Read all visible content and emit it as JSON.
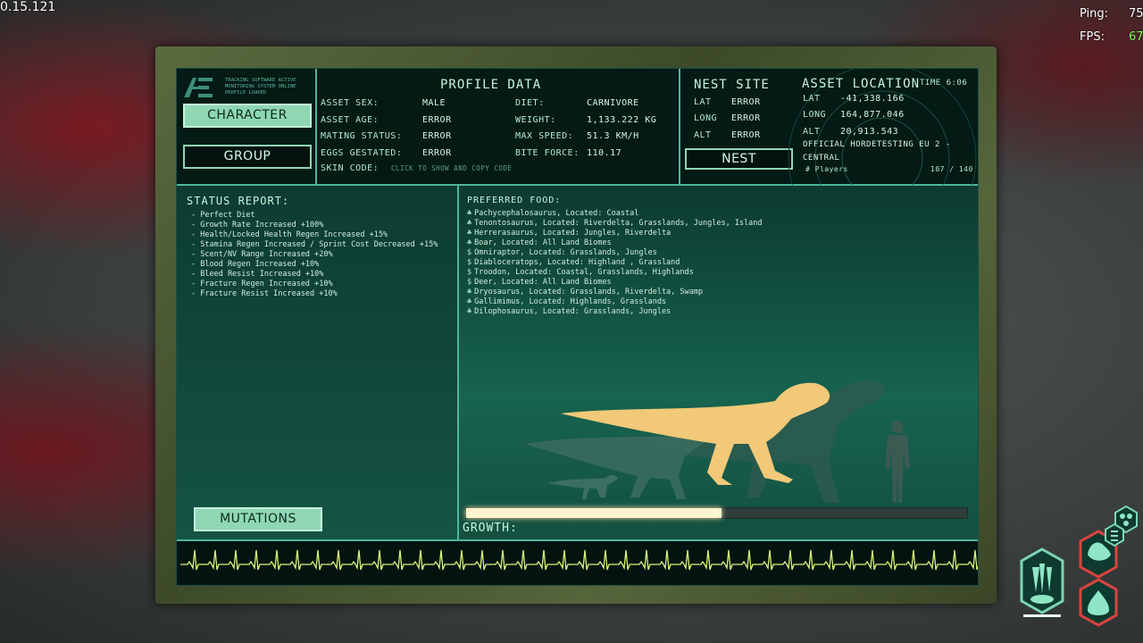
{
  "hud": {
    "version": "0.15.121",
    "ping_label": "Ping:",
    "ping_value": "75",
    "fps_label": "FPS:",
    "fps_value": "67",
    "fps_color": "#7dff5a"
  },
  "logo": {
    "lines": [
      "TRACKING SOFTWARE ACTIVE",
      "MONITORING SYSTEM ONLINE",
      "PROFILE LOADED"
    ]
  },
  "nav": {
    "character_label": "CHARACTER",
    "group_label": "GROUP",
    "nest_label": "NEST",
    "mutations_label": "MUTATIONS"
  },
  "profile": {
    "title": "PROFILE DATA",
    "asset_sex_label": "ASSET SEX:",
    "asset_sex_value": "MALE",
    "asset_age_label": "ASSET AGE:",
    "asset_age_value": "ERROR",
    "mating_status_label": "MATING STATUS:",
    "mating_status_value": "ERROR",
    "eggs_label": "EGGS GESTATED:",
    "eggs_value": "ERROR",
    "skin_code_label": "SKIN CODE:",
    "skin_code_value": "CLICK TO SHOW AND COPY CODE",
    "diet_label": "DIET:",
    "diet_value": "CARNIVORE",
    "weight_label": "WEIGHT:",
    "weight_value": "1,133.222 KG",
    "max_speed_label": "MAX SPEED:",
    "max_speed_value": "51.3 KM/H",
    "bite_force_label": "BITE FORCE:",
    "bite_force_value": "110.17"
  },
  "nest_site": {
    "title": "NEST SITE",
    "lat_label": "LAT",
    "lat_value": "ERROR",
    "long_label": "LONG",
    "long_value": "ERROR",
    "alt_label": "ALT",
    "alt_value": "ERROR"
  },
  "asset_location": {
    "title": "ASSET LOCATION",
    "time": "TIME 6:06",
    "lat_label": "LAT",
    "lat_value": "-41,338.166",
    "long_label": "LONG",
    "long_value": "164,877.046",
    "alt_label": "ALT",
    "alt_value": "20,913.543",
    "server_line1": "OFFICIAL HORDETESTING EU 2 -",
    "server_line2": "CENTRAL",
    "players_label": "# Players",
    "players_value": "107 / 140"
  },
  "status_report": {
    "title": "STATUS REPORT:",
    "items": [
      "- Perfect Diet",
      "- Growth Rate Increased +100%",
      "- Health/Locked Health Regen Increased +15%",
      "- Stamina Regen Increased / Sprint Cost Decreased +15%",
      "- Scent/NV Range Increased +20%",
      "- Blood Regen Increased +10%",
      "- Bleed Resist Increased +10%",
      "- Fracture Regen Increased +10%",
      "- Fracture Resist Increased +10%"
    ]
  },
  "preferred_food": {
    "title": "PREFERRED FOOD:",
    "items": [
      "Pachycephalosaurus, Located: Coastal",
      "Tenontosaurus, Located: Riverdelta, Grasslands, Jungles, Island",
      "Herrerasaurus, Located: Jungles, Riverdelta",
      "Boar, Located: All Land Biomes",
      "Omniraptor, Located: Grasslands, Jungles",
      "Diabloceratops, Located: Highland , Grassland",
      "Troodon, Located: Coastal, Grasslands, Highlands",
      "Deer, Located: All Land Biomes",
      "Dryosaurus, Located: Grasslands, Riverdelta, Swamp",
      "Gallimimus, Located: Highlands, Grasslands",
      "Dilophosaurus, Located: Grasslands, Jungles"
    ]
  },
  "growth": {
    "label": "GROWTH:",
    "fraction": 0.51
  },
  "colors": {
    "accent": "#4fb59a",
    "dino_current": "#f2c978",
    "ecg": "#d7f57a"
  }
}
